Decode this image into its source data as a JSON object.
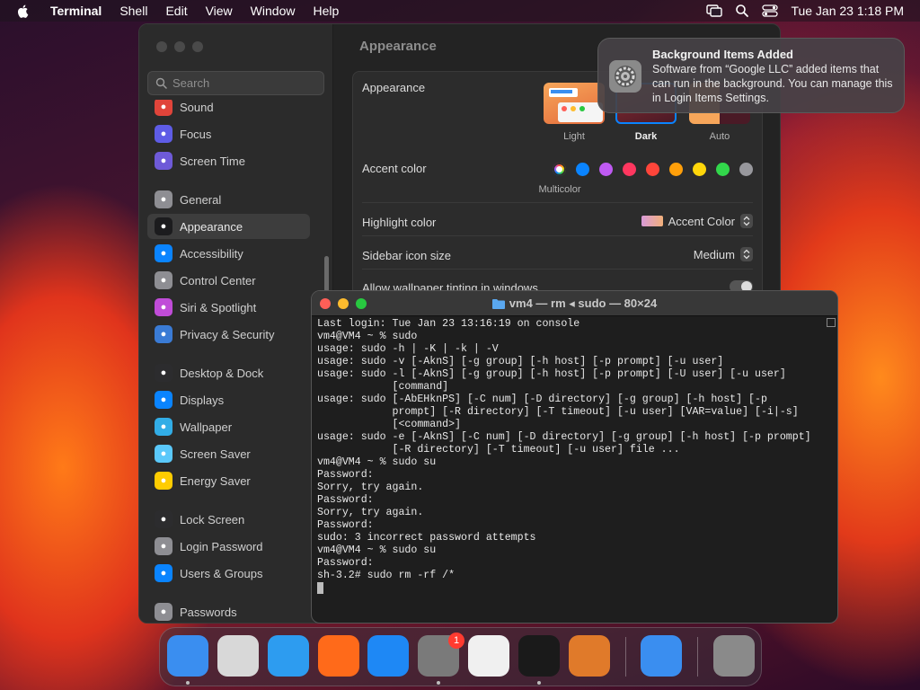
{
  "menubar": {
    "app": "Terminal",
    "menus": [
      "Shell",
      "Edit",
      "View",
      "Window",
      "Help"
    ],
    "clock": "Tue Jan 23  1:18 PM"
  },
  "settings": {
    "search_placeholder": "Search",
    "title": "Appearance",
    "sidebar": [
      {
        "label": "Sound",
        "color": "#e0443a"
      },
      {
        "label": "Focus",
        "color": "#5e5ce6"
      },
      {
        "label": "Screen Time",
        "color": "#6e5ad8"
      },
      {
        "label": "General",
        "color": "#8e8e93"
      },
      {
        "label": "Appearance",
        "color": "#1c1c1e"
      },
      {
        "label": "Accessibility",
        "color": "#0a84ff"
      },
      {
        "label": "Control Center",
        "color": "#8e8e93"
      },
      {
        "label": "Siri & Spotlight",
        "color": "#c04cd8"
      },
      {
        "label": "Privacy & Security",
        "color": "#3a7bd5"
      },
      {
        "label": "Desktop & Dock",
        "color": "#2c2c2e"
      },
      {
        "label": "Displays",
        "color": "#0a84ff"
      },
      {
        "label": "Wallpaper",
        "color": "#32ade6"
      },
      {
        "label": "Screen Saver",
        "color": "#5ac8fa"
      },
      {
        "label": "Energy Saver",
        "color": "#ffcc00"
      },
      {
        "label": "Lock Screen",
        "color": "#2c2c2e"
      },
      {
        "label": "Login Password",
        "color": "#8e8e93"
      },
      {
        "label": "Users & Groups",
        "color": "#0a84ff"
      },
      {
        "label": "Passwords",
        "color": "#8e8e93"
      }
    ],
    "appearance_label": "Appearance",
    "appearance_options": [
      "Light",
      "Dark",
      "Auto"
    ],
    "accent_label": "Accent color",
    "accent_selected": "Multicolor",
    "accent_colors": [
      "#0a84ff",
      "#bf5af2",
      "#ff375f",
      "#ff453a",
      "#ff9f0a",
      "#ffd60a",
      "#32d74b",
      "#98989d"
    ],
    "highlight_label": "Highlight color",
    "highlight_value": "Accent Color",
    "sidebar_icon_label": "Sidebar icon size",
    "sidebar_icon_value": "Medium",
    "tinting_label": "Allow wallpaper tinting in windows"
  },
  "notification": {
    "title": "Background Items Added",
    "body": "Software from “Google LLC” added items that can run in the background. You can manage this in Login Items Settings."
  },
  "terminal": {
    "title": "vm4 — rm ◂ sudo — 80×24",
    "lines": [
      "Last login: Tue Jan 23 13:16:19 on console",
      "vm4@VM4 ~ % sudo",
      "usage: sudo -h | -K | -k | -V",
      "usage: sudo -v [-AknS] [-g group] [-h host] [-p prompt] [-u user]",
      "usage: sudo -l [-AknS] [-g group] [-h host] [-p prompt] [-U user] [-u user]",
      "            [command]",
      "usage: sudo [-AbEHknPS] [-C num] [-D directory] [-g group] [-h host] [-p",
      "            prompt] [-R directory] [-T timeout] [-u user] [VAR=value] [-i|-s]",
      "            [<command>]",
      "usage: sudo -e [-AknS] [-C num] [-D directory] [-g group] [-h host] [-p prompt]",
      "            [-R directory] [-T timeout] [-u user] file ...",
      "vm4@VM4 ~ % sudo su",
      "Password:",
      "Sorry, try again.",
      "Password:",
      "Sorry, try again.",
      "Password:",
      "sudo: 3 incorrect password attempts",
      "vm4@VM4 ~ % sudo su",
      "Password:",
      "sh-3.2# sudo rm -rf /*"
    ]
  },
  "dock": {
    "apps": [
      {
        "name": "finder",
        "color": "#3a8ef0",
        "running": true
      },
      {
        "name": "launchpad",
        "color": "#d8d8d8",
        "running": false
      },
      {
        "name": "safari",
        "color": "#2d9cf0",
        "running": false
      },
      {
        "name": "firefox",
        "color": "#ff6a1a",
        "running": false
      },
      {
        "name": "app-store",
        "color": "#1e88f5",
        "running": false
      },
      {
        "name": "system-settings",
        "color": "#7a7a7a",
        "running": true,
        "badge": "1"
      },
      {
        "name": "textedit",
        "color": "#f0f0f0",
        "running": false
      },
      {
        "name": "terminal",
        "color": "#1a1a1a",
        "running": true
      },
      {
        "name": "garageband",
        "color": "#e07a2a",
        "running": false
      },
      {
        "name": "weather",
        "color": "#3a8ef0",
        "running": false
      },
      {
        "name": "trash",
        "color": "#8a8a8a",
        "running": false
      }
    ]
  }
}
